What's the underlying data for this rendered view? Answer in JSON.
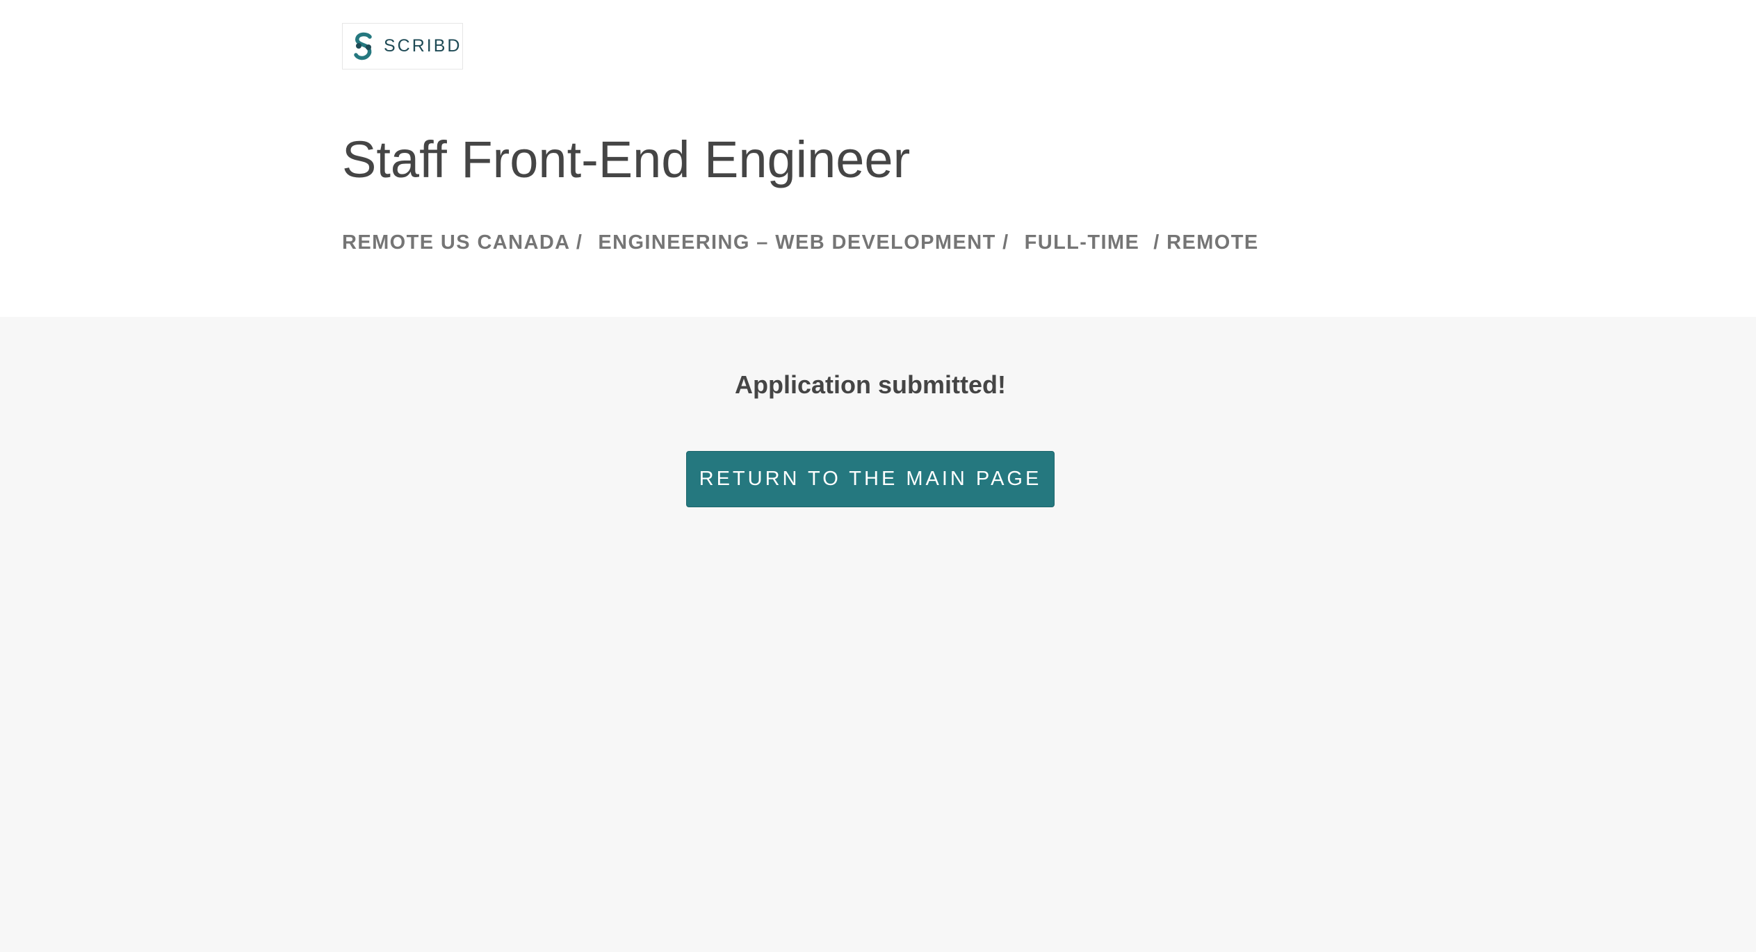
{
  "header": {
    "logo_text": "SCRIBD",
    "logo_icon": "scribd-s-logo-icon",
    "job_title": "Staff Front-End Engineer",
    "categories": [
      "REMOTE US CANADA /",
      "ENGINEERING – WEB DEVELOPMENT /",
      "FULL-TIME",
      "/ REMOTE"
    ]
  },
  "main": {
    "message": "Application submitted!",
    "return_button_label": "RETURN TO THE MAIN PAGE"
  },
  "colors": {
    "accent": "#25787f",
    "logo": "#1e4a55",
    "title_text": "#454545",
    "category_text": "#757575",
    "main_background": "#f7f7f7"
  }
}
